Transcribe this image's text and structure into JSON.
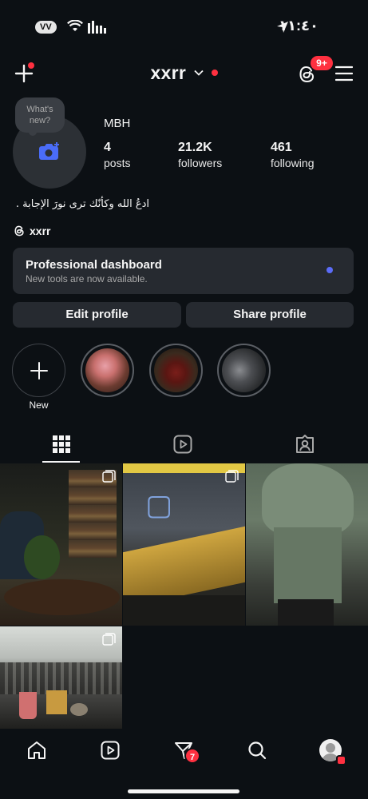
{
  "status_bar": {
    "carrier_badge": "VV",
    "time": "١١:٤٠"
  },
  "header": {
    "username": "xxrr",
    "threads_badge": "9+"
  },
  "profile": {
    "note_text": "What's new?",
    "display_name": "MBH",
    "stats": [
      {
        "value": "4",
        "label": "posts"
      },
      {
        "value": "21.2K",
        "label": "followers"
      },
      {
        "value": "461",
        "label": "following"
      }
    ],
    "bio": "ادعُ الله وكأنّك ترى نورَ الإجابة .",
    "threads_handle": "xxrr"
  },
  "dashboard": {
    "title": "Professional dashboard",
    "subtitle": "New tools are now available."
  },
  "actions": {
    "edit_label": "Edit profile",
    "share_label": "Share profile"
  },
  "highlights": {
    "new_label": "New",
    "count": 3
  },
  "tabs": [
    "grid-icon",
    "reels-icon",
    "tagged-icon"
  ],
  "posts_count_in_grid": 4,
  "bottom_nav": {
    "items": [
      "home-icon",
      "reels-icon",
      "direct-icon",
      "search-icon",
      "profile-avatar"
    ],
    "messages_badge": "7"
  },
  "colors": {
    "background": "#0c1014",
    "surface": "#262a30",
    "badge_red": "#ff3040",
    "accent_blue": "#5b6cf8"
  }
}
